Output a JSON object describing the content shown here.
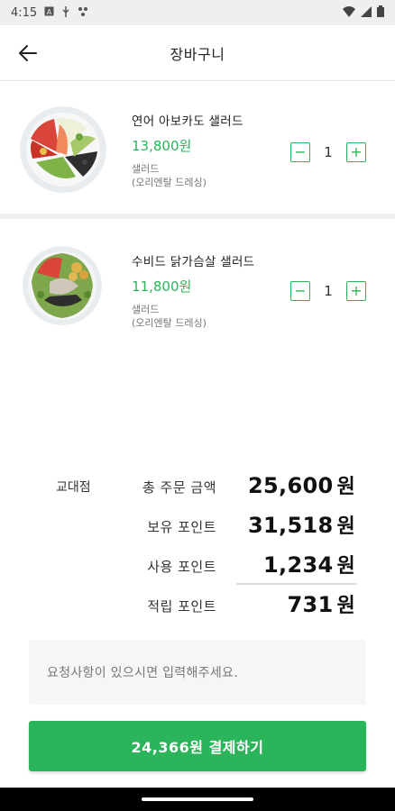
{
  "status": {
    "time": "4:15",
    "left_icons": [
      "notification-a-icon",
      "usb-icon",
      "cast-icon"
    ],
    "right_icons": [
      "wifi-icon",
      "signal-icon",
      "battery-icon"
    ]
  },
  "header": {
    "title": "장바구니",
    "back_icon": "arrow-left-icon"
  },
  "cart": {
    "items": [
      {
        "name": "연어 아보카도 샐러드",
        "price": "13,800원",
        "category": "샐러드",
        "option": "(오리엔탈 드레싱)",
        "quantity": "1",
        "minus": "−",
        "plus": "+"
      },
      {
        "name": "수비드 닭가슴살 샐러드",
        "price": "11,800원",
        "category": "샐러드",
        "option": "(오리엔탈 드레싱)",
        "quantity": "1",
        "minus": "−",
        "plus": "+"
      }
    ]
  },
  "summary": {
    "store": "교대점",
    "rows": [
      {
        "label": "총 주문 금액",
        "value": "25,600",
        "unit": "원"
      },
      {
        "label": "보유 포인트",
        "value": "31,518",
        "unit": "원"
      },
      {
        "label": "사용 포인트",
        "value": "1,234",
        "unit": "원"
      },
      {
        "label": "적립 포인트",
        "value": "731",
        "unit": "원"
      }
    ]
  },
  "request": {
    "placeholder": "요청사항이 있으시면 입력해주세요."
  },
  "pay": {
    "label": "24,366원 결제하기"
  },
  "colors": {
    "accent": "#2bb55a"
  }
}
